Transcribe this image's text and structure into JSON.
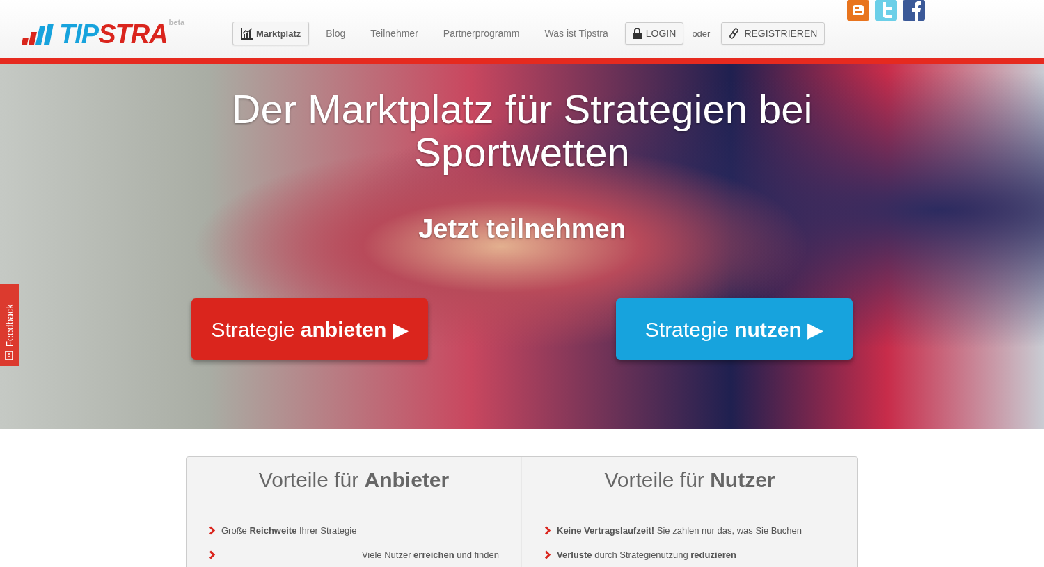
{
  "logo": {
    "part_1": "TIP",
    "part_2": "STRA",
    "badge": "beta"
  },
  "nav": [
    {
      "label": "Marktplatz",
      "selected": true
    },
    {
      "label": "Blog",
      "selected": false
    },
    {
      "label": "Teilnehmer",
      "selected": false
    },
    {
      "label": "Partnerprogramm",
      "selected": false
    },
    {
      "label": "Was ist Tipstra",
      "selected": false
    }
  ],
  "login": "LOGIN",
  "separator": "oder",
  "register": "REGISTRIEREN",
  "hero": {
    "title": "Der Marktplatz für Strategien bei Sportwetten",
    "subtitle": "Jetzt teilnehmen",
    "buttons": [
      {
        "label": "Strategie **anbieten**",
        "arrow": "▶",
        "color": "#da251d"
      },
      {
        "label": "Strategie **nutzen**",
        "arrow": "▶",
        "color": "#17a3dd"
      }
    ]
  },
  "feedback": "Feedback",
  "benefits": [
    {
      "title": "Vorteile für **Anbieter**",
      "items": [
        {
          "text": "Große **Reichweite** Ihrer Strategie",
          "kind": "plain"
        },
        {
          "text": "Viele Nutzer **erreichen** und finden",
          "kind": "pushed"
        }
      ]
    },
    {
      "title": "Vorteile für **Nutzer**",
      "items": [
        {
          "text": "**Keine Vertragslaufzeit!** Sie zahlen nur das, was Sie Buchen",
          "kind": "plain"
        },
        {
          "text": "**Verluste** durch Strategienutzung **reduzieren**",
          "kind": "plain"
        }
      ]
    }
  ]
}
